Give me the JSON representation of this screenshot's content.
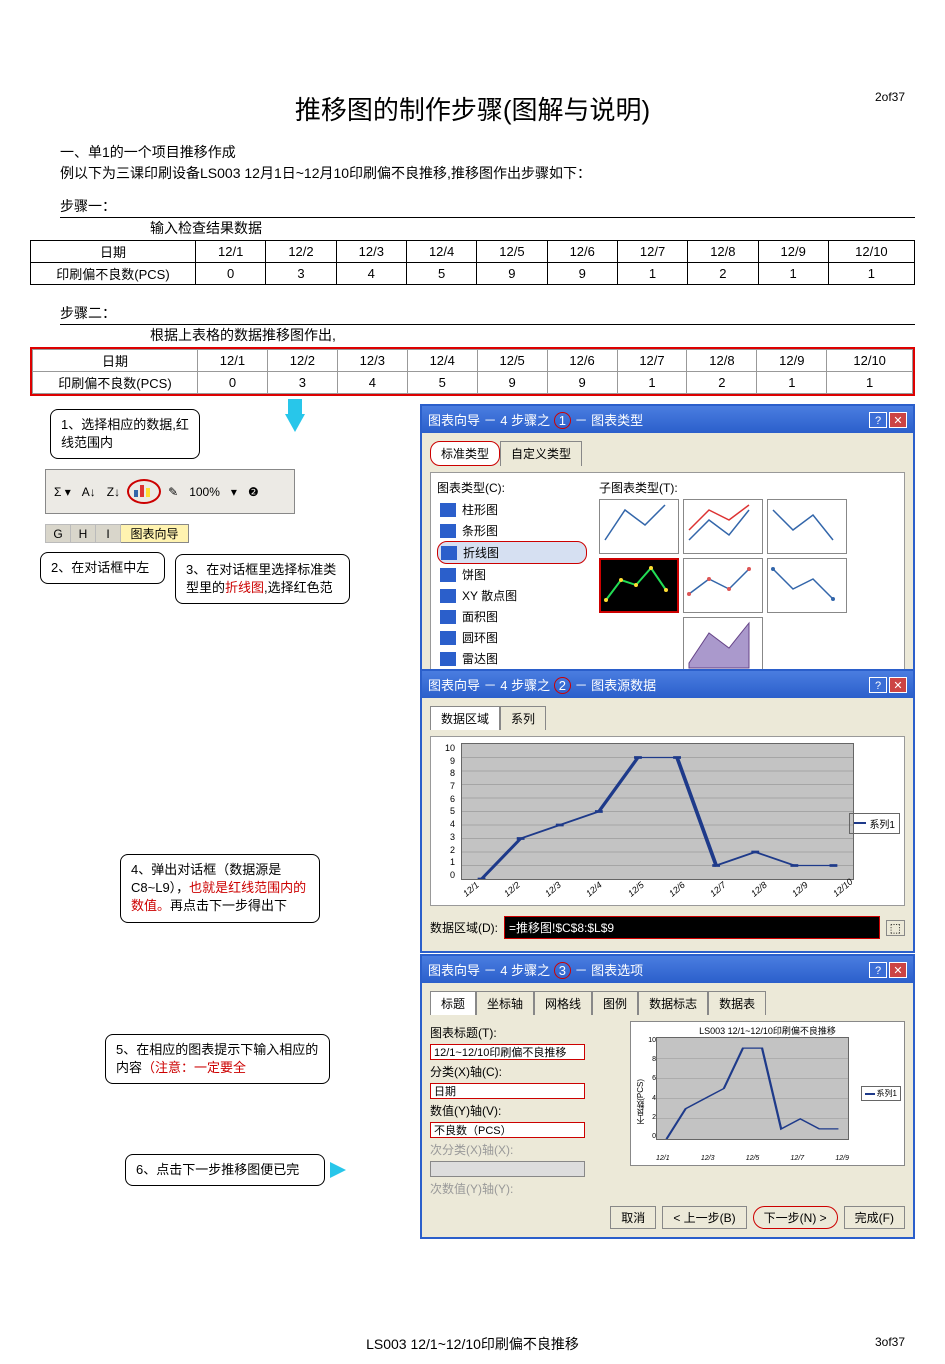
{
  "pageTop": "2of37",
  "pageBottom": "3of37",
  "title": "推移图的制作步骤(图解与说明)",
  "intro1": "一、单1的一个项目推移作成",
  "intro2": "例以下为三课印刷设备LS003 12月1日~12月10印刷偏不良推移,推移图作出步骤如下：",
  "step1": "步骤一：",
  "step1sub": "输入检查结果数据",
  "table": {
    "rowLabels": [
      "日期",
      "印刷偏不良数(PCS)"
    ],
    "dates": [
      "12/1",
      "12/2",
      "12/3",
      "12/4",
      "12/5",
      "12/6",
      "12/7",
      "12/8",
      "12/9",
      "12/10"
    ],
    "values": [
      "0",
      "3",
      "4",
      "5",
      "9",
      "9",
      "1",
      "2",
      "1",
      "1"
    ]
  },
  "step2": "步骤二：",
  "step2sub": "根据上表格的数据推移图作出,",
  "callouts": {
    "c1": "1、选择相应的数据,红线范围内",
    "c2": "2、在对话框中左",
    "c3a": "3、在对话框里选择标准类型里的",
    "c3b": "折线图",
    "c3c": ",选择红色范",
    "c4a": "4、弹出对话框（数据源是C8~L9），",
    "c4b": "也就是红线范围内的数值。",
    "c4c": "再点击下一步得出下",
    "c5a": "5、在相应的图表提示下输入相应的内容",
    "c5b": "（注意：一定要全",
    "c6": "6、点击下一步推移图便已完"
  },
  "toolbar": {
    "zoom": "100%",
    "wizardLabel": "图表向导",
    "cols": [
      "G",
      "H",
      "I"
    ]
  },
  "wiz1": {
    "titleA": "图表向导 － 4 步骤之",
    "stepNum": "1",
    "titleB": "－ 图表类型",
    "tab1": "标准类型",
    "tab2": "自定义类型",
    "listLabel": "图表类型(C):",
    "subLabel": "子图表类型(T):",
    "types": [
      "柱形图",
      "条形图",
      "折线图",
      "饼图",
      "XY 散点图",
      "面积图",
      "圆环图",
      "雷达图"
    ]
  },
  "wiz2": {
    "titleA": "图表向导 － 4 步骤之",
    "stepNum": "2",
    "titleB": "－ 图表源数据",
    "tab1": "数据区域",
    "tab2": "系列",
    "rangeLabel": "数据区域(D):",
    "rangeValue": "=推移图!$C$8:$L$9",
    "legend": "系列1"
  },
  "wiz3": {
    "titleA": "图表向导 － 4 步骤之",
    "stepNum": "3",
    "titleB": "－ 图表选项",
    "tabs": [
      "标题",
      "坐标轴",
      "网格线",
      "图例",
      "数据标志",
      "数据表"
    ],
    "grpLabel": "图表标题(T):",
    "titleVal": "12/1~12/10印刷偏不良推移",
    "xLabel": "分类(X)轴(C):",
    "xVal": "日期",
    "yLabel": "数值(Y)轴(V):",
    "yVal": "不良数（PCS）",
    "x2Label": "次分类(X)轴(X):",
    "y2Label": "次数值(Y)轴(Y):",
    "previewTitle": "LS003 12/1~12/10印刷偏不良推移",
    "previewY": "不良数(PCS)",
    "previewLegend": "系列1"
  },
  "buttons": {
    "cancel": "取消",
    "back": "< 上一步(B)",
    "next": "下一步(N) >",
    "finish": "完成(F)"
  },
  "chart_data": {
    "type": "line",
    "title": "LS003 12/1~12/10印刷偏不良推移",
    "xlabel": "日期",
    "ylabel": "不良数(PCS)",
    "categories": [
      "12/1",
      "12/2",
      "12/3",
      "12/4",
      "12/5",
      "12/6",
      "12/7",
      "12/8",
      "12/9",
      "12/10"
    ],
    "series": [
      {
        "name": "系列1",
        "values": [
          0,
          3,
          4,
          5,
          9,
          9,
          1,
          2,
          1,
          1
        ]
      }
    ],
    "ylim": [
      0,
      10
    ]
  },
  "footerTitle": "LS003 12/1~12/10印刷偏不良推移"
}
